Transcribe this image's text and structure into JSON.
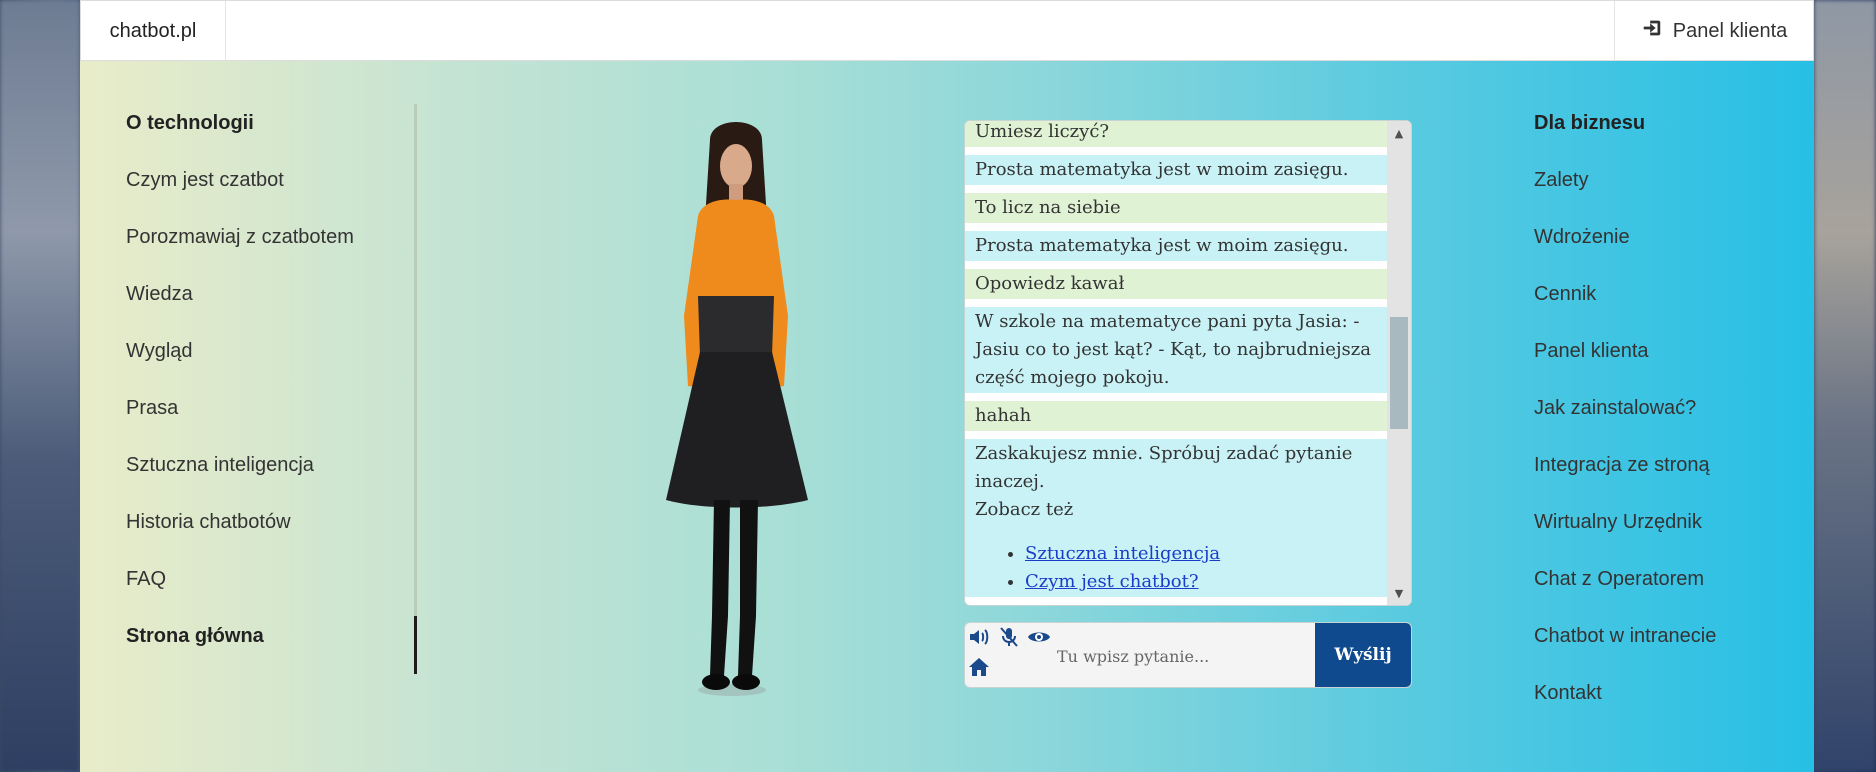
{
  "navbar": {
    "brand": "chatbot.pl",
    "panel_label": "Panel klienta",
    "panel_icon": "sign-in-icon"
  },
  "left_menu": [
    {
      "label": "O technologii",
      "bold": true
    },
    {
      "label": "Czym jest czatbot",
      "bold": false
    },
    {
      "label": "Porozmawiaj z czatbotem",
      "bold": false
    },
    {
      "label": "Wiedza",
      "bold": false
    },
    {
      "label": "Wygląd",
      "bold": false
    },
    {
      "label": "Prasa",
      "bold": false
    },
    {
      "label": "Sztuczna inteligencja",
      "bold": false
    },
    {
      "label": "Historia chatbotów",
      "bold": false
    },
    {
      "label": "FAQ",
      "bold": false
    },
    {
      "label": "Strona główna",
      "bold": true
    }
  ],
  "right_menu": [
    {
      "label": "Dla biznesu",
      "bold": true
    },
    {
      "label": "Zalety",
      "bold": false
    },
    {
      "label": "Wdrożenie",
      "bold": false
    },
    {
      "label": "Cennik",
      "bold": false
    },
    {
      "label": "Panel klienta",
      "bold": false
    },
    {
      "label": "Jak zainstalować?",
      "bold": false
    },
    {
      "label": "Integracja ze stroną",
      "bold": false
    },
    {
      "label": "Wirtualny Urzędnik",
      "bold": false
    },
    {
      "label": "Chat z Operatorem",
      "bold": false
    },
    {
      "label": "Chatbot w intranecie",
      "bold": false
    },
    {
      "label": "Kontakt",
      "bold": false
    }
  ],
  "chat": {
    "messages": [
      {
        "role": "user",
        "text": "Umiesz liczyć?"
      },
      {
        "role": "bot",
        "text": "Prosta matematyka jest w moim zasięgu."
      },
      {
        "role": "user",
        "text": "To licz na siebie"
      },
      {
        "role": "bot",
        "text": "Prosta matematyka jest w moim zasięgu."
      },
      {
        "role": "user",
        "text": "Opowiedz kawał"
      },
      {
        "role": "bot",
        "text": "W szkole na matematyce pani pyta Jasia: - Jasiu co to jest kąt? - Kąt, to najbrudniejsza część mojego pokoju."
      },
      {
        "role": "user",
        "text": "hahah"
      },
      {
        "role": "bot",
        "text": "Zaskakujesz mnie. Spróbuj zadać pytanie inaczej.",
        "extra": "Zobacz też",
        "links": [
          "Sztuczna inteligencja",
          "Czym jest chatbot?"
        ]
      }
    ],
    "scroll_position": 0.45
  },
  "input": {
    "placeholder": "Tu wpisz pytanie...",
    "send_label": "Wyślij",
    "icons": [
      "speaker-icon",
      "mic-off-icon",
      "eye-icon",
      "home-icon"
    ]
  },
  "colors": {
    "user_bubble": "#dff2d4",
    "bot_bubble": "#c8f2f6",
    "send_button": "#0f4a8e",
    "link": "#1a3cc8"
  }
}
